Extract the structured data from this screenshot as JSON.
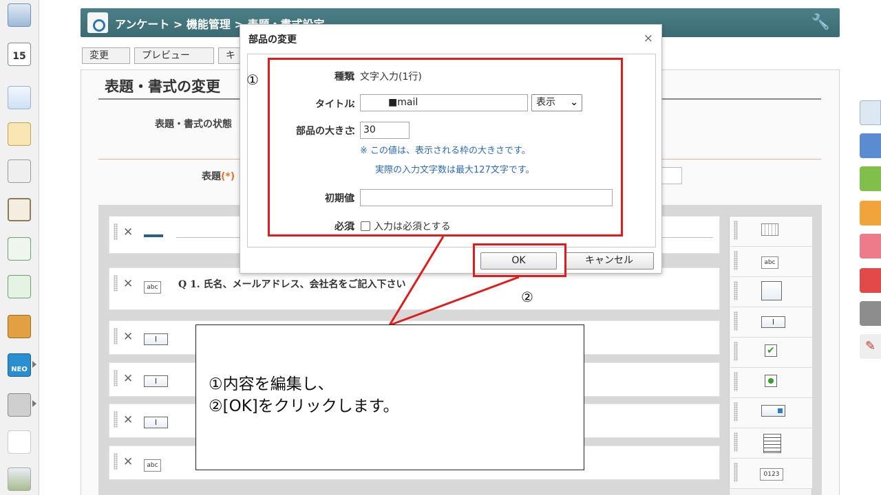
{
  "header": {
    "breadcrumb": "アンケート > 機能管理 > 表題・書式設定"
  },
  "toolbar_tabs": [
    "変更",
    "プレビュー",
    "キ"
  ],
  "page": {
    "title": "表題・書式の変更",
    "status_label": "表題・書式の状態",
    "title_label": "表題",
    "required_mark": "(*)"
  },
  "rows": [
    {
      "type": "line",
      "question": ""
    },
    {
      "type": "abc",
      "question": "Q 1. 氏名、メールアドレス、会社名をご記入下さい"
    },
    {
      "type": "field",
      "question": ""
    },
    {
      "type": "field",
      "question": ""
    },
    {
      "type": "field",
      "question": ""
    },
    {
      "type": "abc",
      "question": ""
    }
  ],
  "palette": {
    "abc_label": "abc",
    "field_label": "I",
    "number_label": "0123"
  },
  "dialog": {
    "title": "部品の変更",
    "close_glyph": "×",
    "type_label": "種類",
    "type_value": "文字入力(1行)",
    "title_field_label": "タイトル",
    "title_field_value": "■mail",
    "display_select_value": "表示",
    "size_label": "部品の大きさ",
    "size_value": "30",
    "size_note_1": "※ この値は、表示される枠の大きさです。",
    "size_note_2": "実際の入力文字数は最大127文字です。",
    "default_label": "初期値",
    "default_value": "",
    "required_label": "必須",
    "required_checkbox_label": "入力は必須とする",
    "required_checked": false,
    "colon": "：",
    "ok_label": "OK",
    "cancel_label": "キャンセル"
  },
  "annotations": {
    "marker_1": "①",
    "marker_2": "②",
    "callout_line_1": "①内容を編集し、",
    "callout_line_2": "②[OK]をクリックします。",
    "highlight_color": "#e01b1b"
  }
}
